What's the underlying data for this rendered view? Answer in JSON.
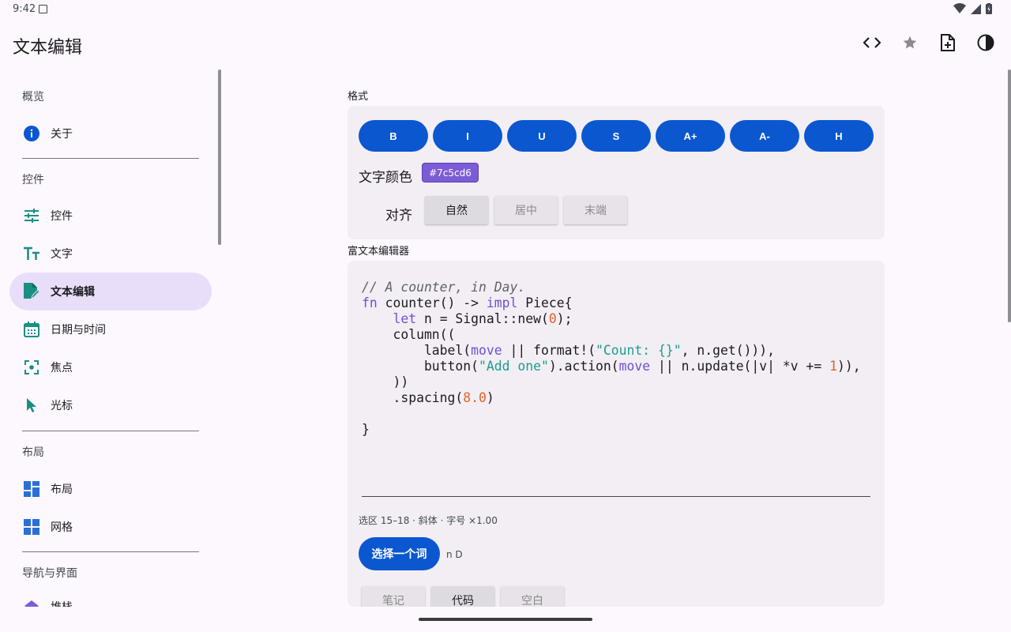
{
  "status": {
    "time": "9:42"
  },
  "appbar": {
    "title": "文本编辑"
  },
  "sidebar": {
    "sections": [
      {
        "title": "概览",
        "items": [
          {
            "label": "关于",
            "icon": "info-icon"
          }
        ]
      },
      {
        "title": "控件",
        "items": [
          {
            "label": "控件",
            "icon": "tune-icon"
          },
          {
            "label": "文字",
            "icon": "text-size-icon"
          },
          {
            "label": "文本编辑",
            "icon": "edit-document-icon",
            "active": true
          },
          {
            "label": "日期与时间",
            "icon": "calendar-icon"
          },
          {
            "label": "焦点",
            "icon": "focus-icon"
          },
          {
            "label": "光标",
            "icon": "cursor-icon"
          }
        ]
      },
      {
        "title": "布局",
        "items": [
          {
            "label": "布局",
            "icon": "dashboard-icon"
          },
          {
            "label": "网格",
            "icon": "grid-icon"
          }
        ]
      },
      {
        "title": "导航与界面",
        "items": [
          {
            "label": "堆栈",
            "icon": "layers-icon"
          }
        ]
      }
    ]
  },
  "format": {
    "section_label": "格式",
    "buttons": [
      "B",
      "I",
      "U",
      "S",
      "A+",
      "A-",
      "H"
    ],
    "color_label": "文字颜色",
    "color_value": "#7c5cd6",
    "align_label": "对齐",
    "align_options": [
      "自然",
      "居中",
      "末端"
    ],
    "align_selected": "自然"
  },
  "editor": {
    "section_label": "富文本编辑器",
    "status": "选区 15–18 · 斜体 · 字号 ×1.00",
    "pick_button": "选择一个词",
    "pick_result": "n D",
    "presets": [
      "笔记",
      "代码",
      "空白"
    ],
    "preset_selected": "代码"
  },
  "colors": {
    "accent": "#0b57d0",
    "nav_active": "#e8defa",
    "teal": "#1a8f83",
    "chip": "#7c5cd6"
  }
}
